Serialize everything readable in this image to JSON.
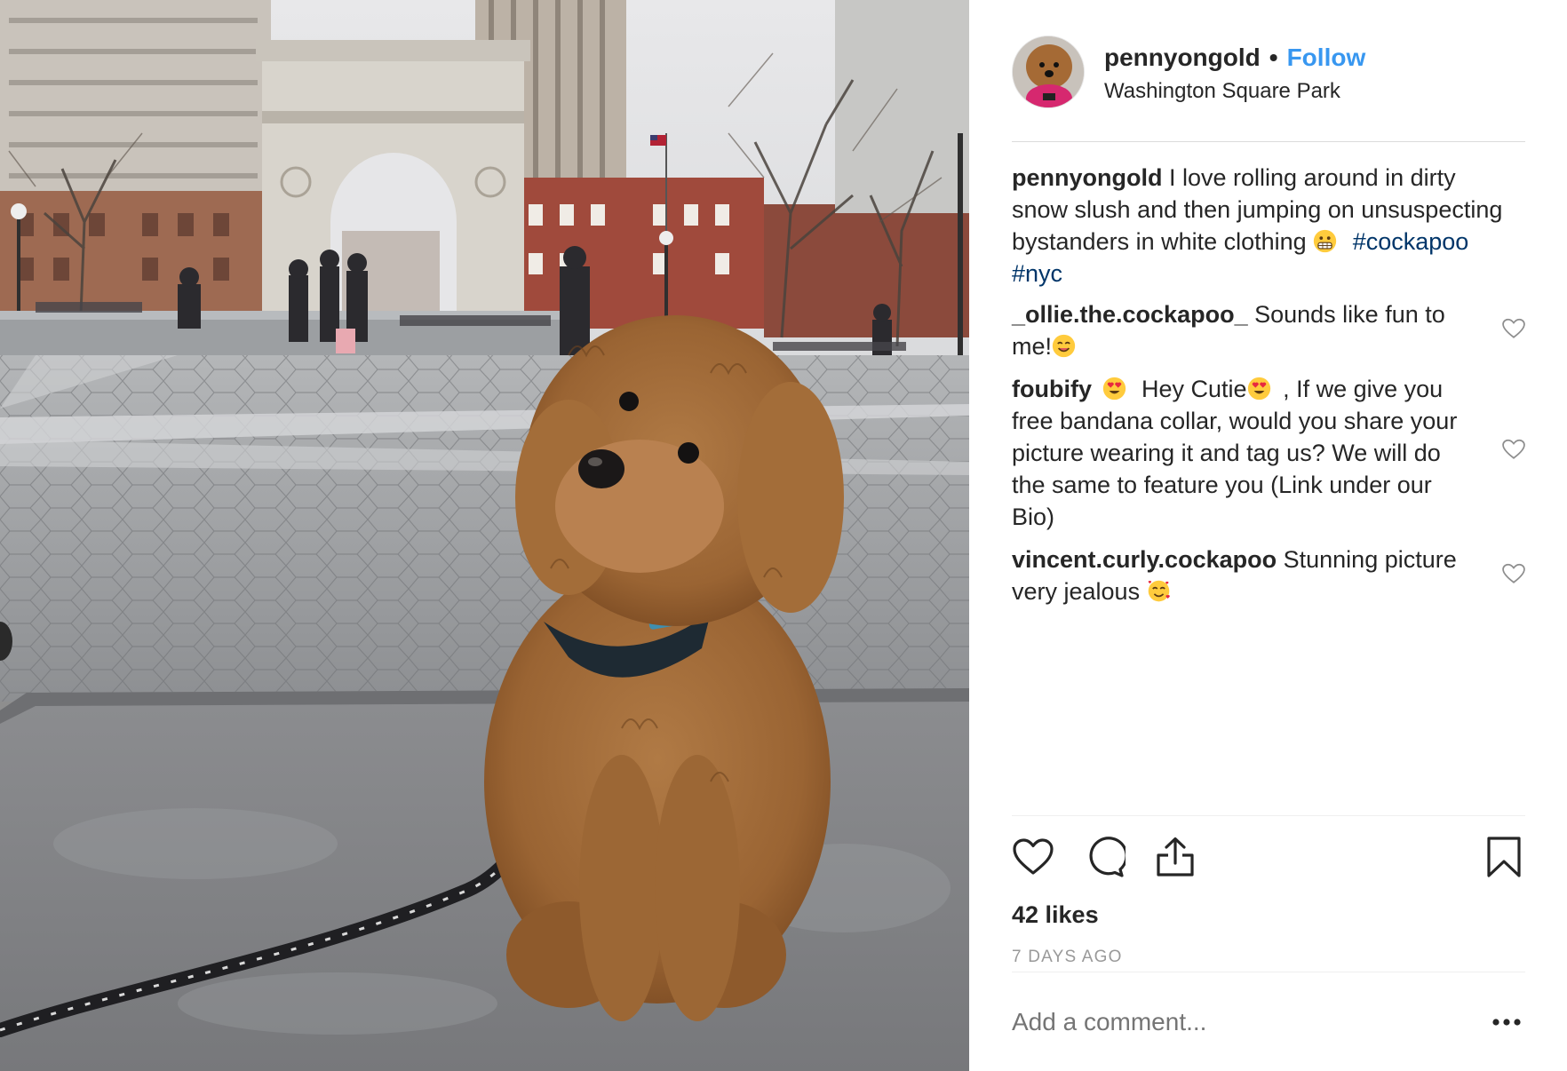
{
  "header": {
    "username": "pennyongold",
    "separator": "•",
    "follow_label": "Follow",
    "location": "Washington Square Park"
  },
  "caption": {
    "username": "pennyongold",
    "text": "I love rolling around in dirty snow slush and then jumping on unsuspecting bystanders in white clothing",
    "emoji": "grimacing-face",
    "hashtags": [
      "#cockapoo",
      "#nyc"
    ]
  },
  "comments": [
    {
      "username": "_ollie.the.cockapoo_",
      "text": "Sounds like fun to me!",
      "emoji_after": "smiling-face"
    },
    {
      "username": "foubify",
      "emoji_after_user": "heart-eyes",
      "text_a": "Hey Cutie",
      "emoji_mid": "heart-eyes",
      "text_b": ", If we give you free bandana collar, would you share your picture wearing it and tag us? We will do the same to feature you (Link under our Bio)"
    },
    {
      "username": "vincent.curly.cockapoo",
      "text": "Stunning picture very jealous",
      "emoji_after": "smiling-face-with-hearts"
    }
  ],
  "actions": {
    "like_icon": "heart-icon",
    "comment_icon": "comment-icon",
    "share_icon": "share-icon",
    "save_icon": "bookmark-icon"
  },
  "likes": "42 likes",
  "time_ago": "7 DAYS AGO",
  "add_comment": {
    "placeholder": "Add a comment...",
    "more_icon": "more-icon"
  },
  "colors": {
    "link_blue": "#3897f0",
    "hashtag": "#003569",
    "muted": "#999999",
    "text": "#262626"
  }
}
